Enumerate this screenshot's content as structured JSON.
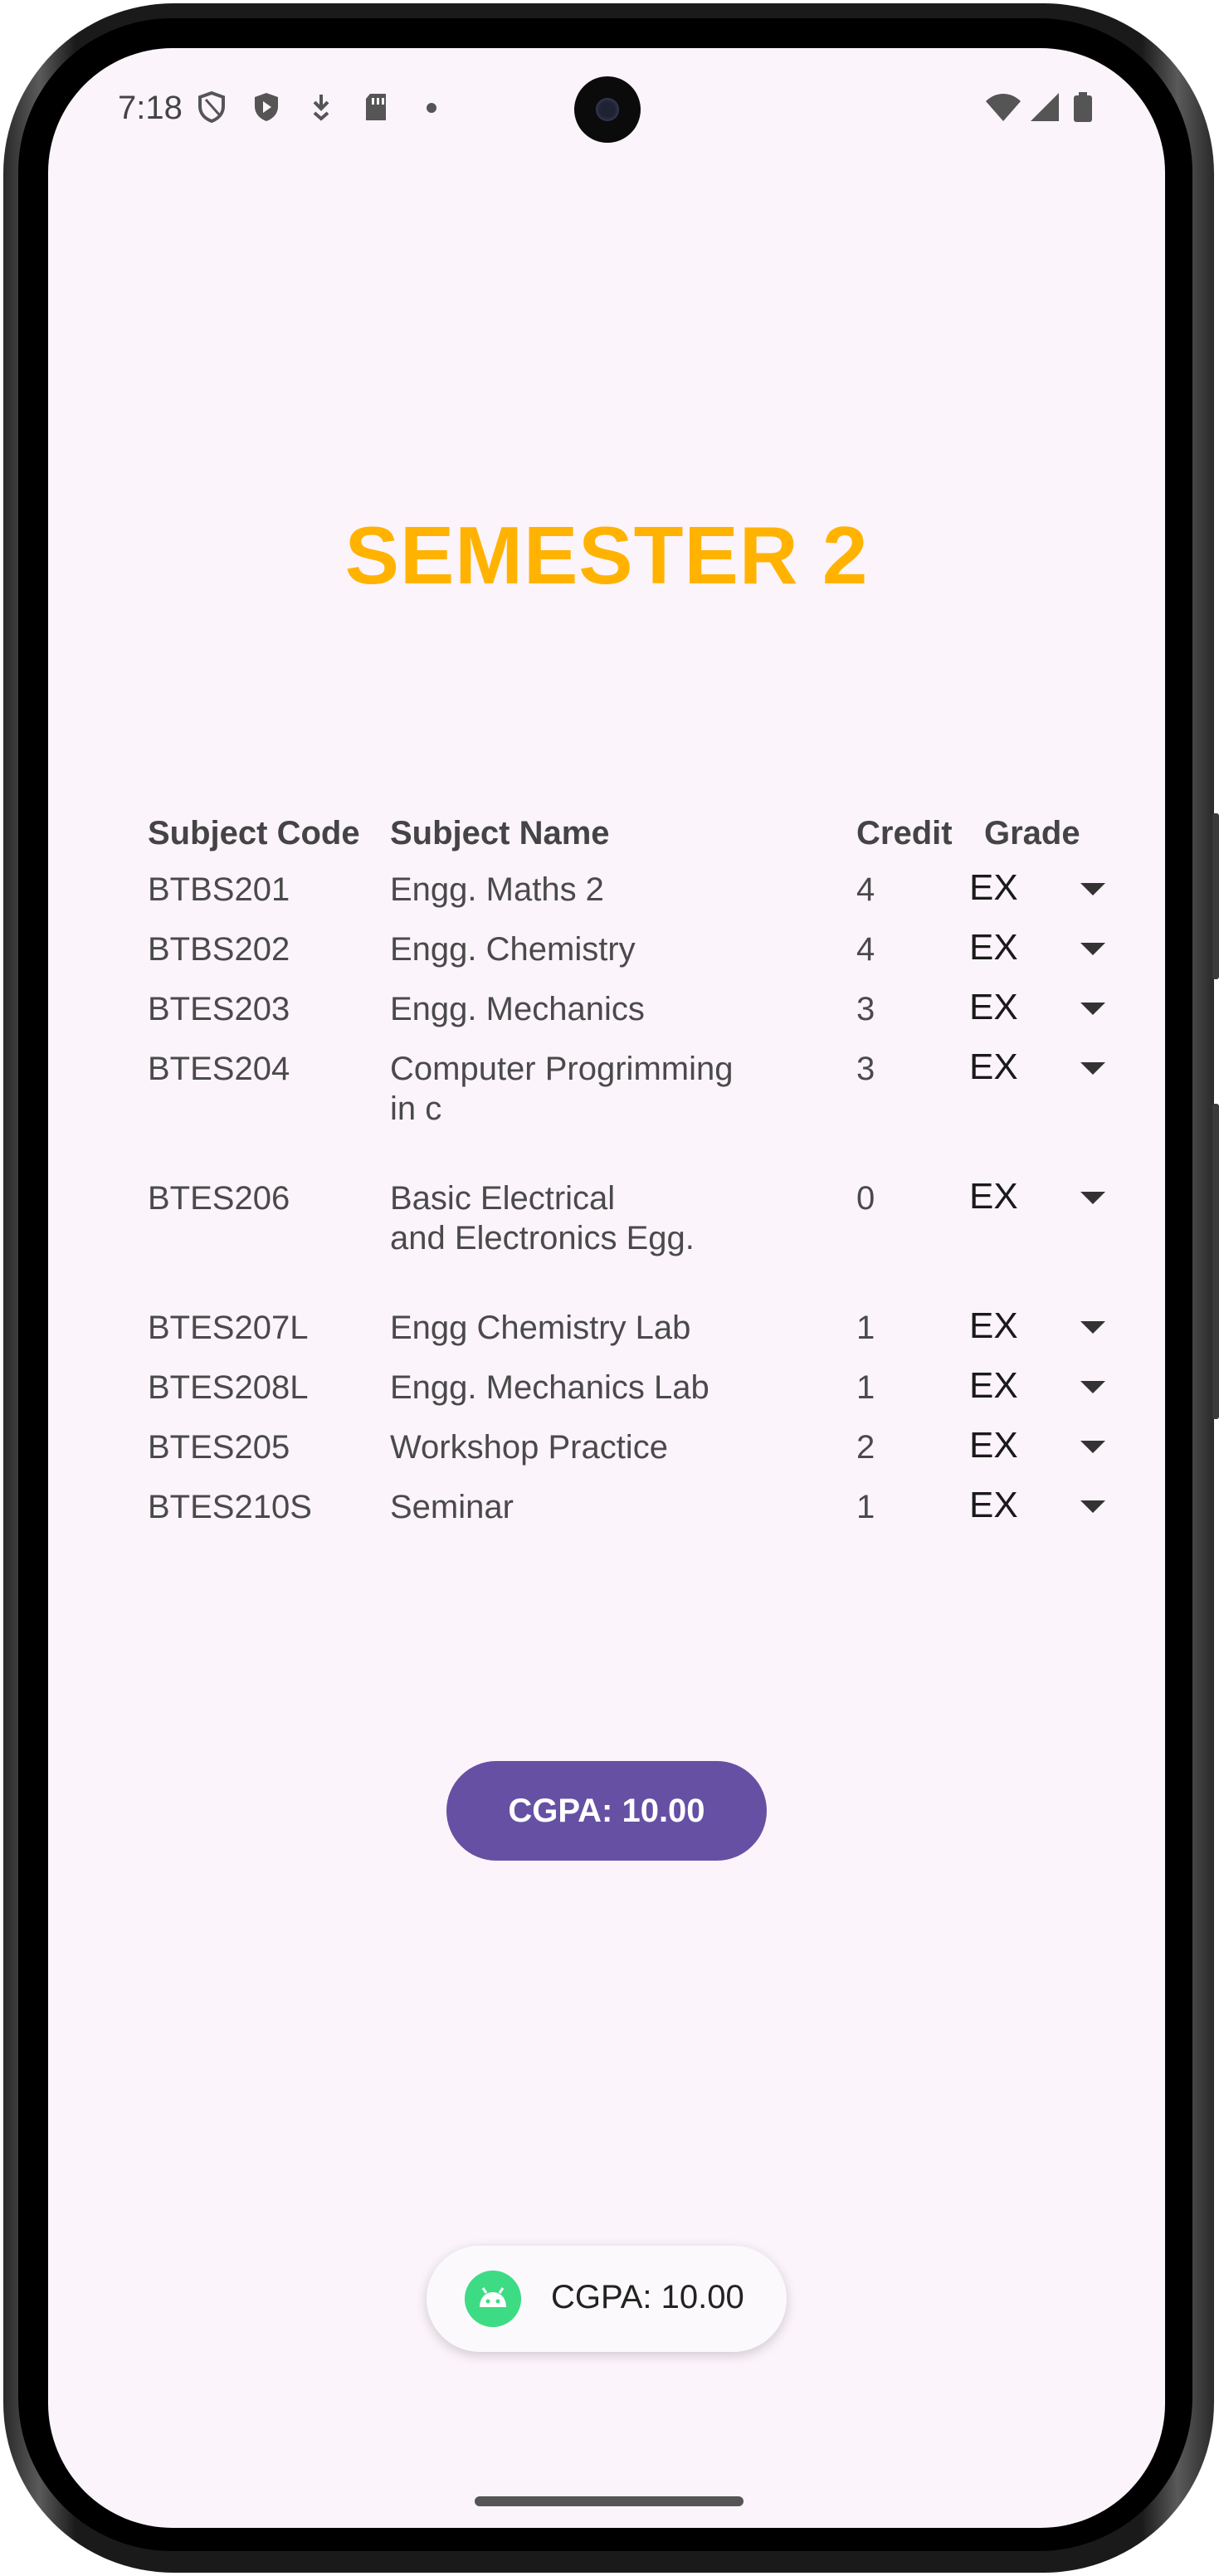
{
  "status_bar": {
    "time": "7:18"
  },
  "title": "SEMESTER 2",
  "table": {
    "headers": {
      "code": "Subject Code",
      "name": "Subject Name",
      "credit": "Credit",
      "grade": "Grade"
    },
    "rows": [
      {
        "code": "BTBS201",
        "name": "Engg. Maths 2",
        "credit": "4",
        "grade": "EX"
      },
      {
        "code": "BTBS202",
        "name": "Engg. Chemistry",
        "credit": "4",
        "grade": "EX"
      },
      {
        "code": "BTES203",
        "name": "Engg. Mechanics",
        "credit": "3",
        "grade": "EX"
      },
      {
        "code": "BTES204",
        "name": "Computer Progrimming\nin c",
        "credit": "3",
        "grade": "EX"
      },
      {
        "code": "BTES206",
        "name": "Basic Electrical\nand Electronics Egg.",
        "credit": "0",
        "grade": "EX"
      },
      {
        "code": "BTES207L",
        "name": "Engg Chemistry Lab",
        "credit": "1",
        "grade": "EX"
      },
      {
        "code": "BTES208L",
        "name": "Engg. Mechanics Lab",
        "credit": "1",
        "grade": "EX"
      },
      {
        "code": "BTES205",
        "name": "Workshop Practice",
        "credit": "2",
        "grade": "EX"
      },
      {
        "code": "BTES210S",
        "name": "Seminar",
        "credit": "1",
        "grade": "EX"
      }
    ]
  },
  "cgpa_button_label": "CGPA: 10.00",
  "toast": {
    "icon": "android-icon",
    "text": "CGPA: 10.00"
  },
  "colors": {
    "title": "#ffb300",
    "button": "#6650a4",
    "background": "#fcf4fb"
  }
}
